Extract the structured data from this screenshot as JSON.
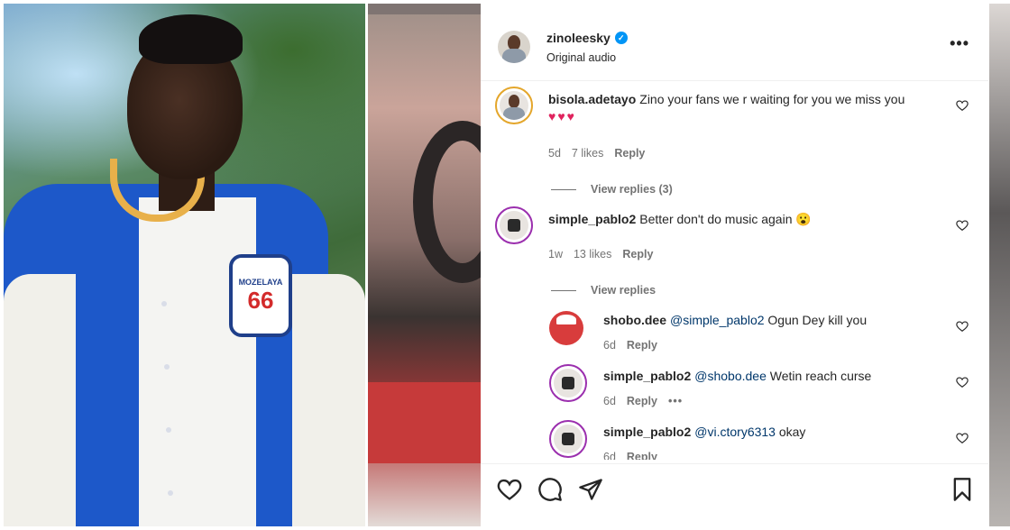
{
  "header": {
    "username": "zinoleesky",
    "subtitle": "Original audio",
    "verified_icon": "verified-badge-icon",
    "more_icon": "more-options-icon"
  },
  "comments": [
    {
      "username": "bisola.adetayo",
      "text": "Zino your fans we r waiting for you we miss you",
      "emoji": "♥♥♥",
      "time": "5d",
      "likes": "7 likes",
      "reply": "Reply",
      "view_replies": "View replies (3)"
    },
    {
      "username": "simple_pablo2",
      "text": "Better don't do music again",
      "emoji": "😮",
      "time": "1w",
      "likes": "13 likes",
      "reply": "Reply",
      "view_replies": "View replies"
    }
  ],
  "replies": [
    {
      "username": "shobo.dee",
      "mention": "@simple_pablo2",
      "text": "Ogun Dey kill you",
      "time": "6d",
      "reply": "Reply"
    },
    {
      "username": "simple_pablo2",
      "mention": "@shobo.dee",
      "text": "Wetin reach curse",
      "time": "6d",
      "reply": "Reply",
      "more": "•••"
    },
    {
      "username": "simple_pablo2",
      "mention": "@vi.ctory6313",
      "text": "okay",
      "time": "6d",
      "reply": "Reply"
    }
  ],
  "photo": {
    "patch_top": "MOZELAYA",
    "patch_number": "66"
  },
  "actions": [
    "like-icon",
    "comment-icon",
    "share-icon",
    "save-icon"
  ],
  "colors": {
    "verified": "#0095f6",
    "heart": "#e0245e",
    "mention": "#00376b",
    "jacket": "#1d58c9"
  }
}
